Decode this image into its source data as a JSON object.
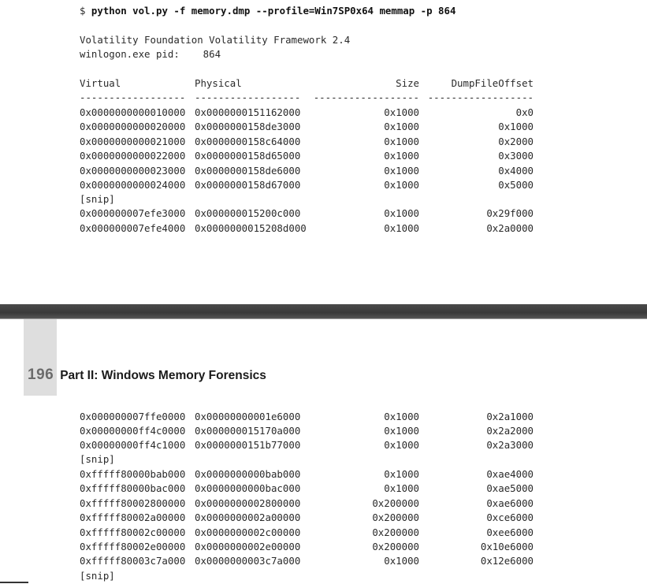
{
  "command": {
    "prompt": "$ ",
    "text": "python vol.py -f memory.dmp --profile=Win7SP0x64 memmap -p 864"
  },
  "output": {
    "banner": "Volatility Foundation Volatility Framework 2.4",
    "pid_label": "winlogon.exe pid:",
    "pid_value": "864"
  },
  "table": {
    "headers": {
      "virtual": "Virtual",
      "physical": "Physical",
      "size": "Size",
      "offset": "DumpFileOffset"
    },
    "separators": {
      "virtual": "------------------",
      "physical": "------------------",
      "size": "------------------",
      "offset": "------------------"
    },
    "snip": "[snip]",
    "rows_top_a": [
      {
        "virtual": "0x0000000000010000",
        "physical": "0x0000000151162000",
        "size": "0x1000",
        "offset": "0x0"
      },
      {
        "virtual": "0x0000000000020000",
        "physical": "0x0000000158de3000",
        "size": "0x1000",
        "offset": "0x1000"
      },
      {
        "virtual": "0x0000000000021000",
        "physical": "0x0000000158c64000",
        "size": "0x1000",
        "offset": "0x2000"
      },
      {
        "virtual": "0x0000000000022000",
        "physical": "0x0000000158d65000",
        "size": "0x1000",
        "offset": "0x3000"
      },
      {
        "virtual": "0x0000000000023000",
        "physical": "0x0000000158de6000",
        "size": "0x1000",
        "offset": "0x4000"
      },
      {
        "virtual": "0x0000000000024000",
        "physical": "0x0000000158d67000",
        "size": "0x1000",
        "offset": "0x5000"
      }
    ],
    "rows_top_b": [
      {
        "virtual": "0x000000007efe3000",
        "physical": "0x000000015200c000",
        "size": "0x1000",
        "offset": "0x29f000"
      },
      {
        "virtual": "0x000000007efe4000",
        "physical": "0x0000000015208d000",
        "size": "0x1000",
        "offset": "0x2a0000"
      }
    ],
    "rows_bottom_a": [
      {
        "virtual": "0x000000007ffe0000",
        "physical": "0x00000000001e6000",
        "size": "0x1000",
        "offset": "0x2a1000"
      },
      {
        "virtual": "0x00000000ff4c0000",
        "physical": "0x000000015170a000",
        "size": "0x1000",
        "offset": "0x2a2000"
      },
      {
        "virtual": "0x00000000ff4c1000",
        "physical": "0x0000000151b77000",
        "size": "0x1000",
        "offset": "0x2a3000"
      }
    ],
    "rows_bottom_b": [
      {
        "virtual": "0xfffff80000bab000",
        "physical": "0x0000000000bab000",
        "size": "0x1000",
        "offset": "0xae4000"
      },
      {
        "virtual": "0xfffff80000bac000",
        "physical": "0x0000000000bac000",
        "size": "0x1000",
        "offset": "0xae5000"
      },
      {
        "virtual": "0xfffff80002800000",
        "physical": "0x0000000002800000",
        "size": "0x200000",
        "offset": "0xae6000"
      },
      {
        "virtual": "0xfffff80002a00000",
        "physical": "0x0000000002a00000",
        "size": "0x200000",
        "offset": "0xce6000"
      },
      {
        "virtual": "0xfffff80002c00000",
        "physical": "0x0000000002c00000",
        "size": "0x200000",
        "offset": "0xee6000"
      },
      {
        "virtual": "0xfffff80002e00000",
        "physical": "0x0000000002e00000",
        "size": "0x200000",
        "offset": "0x10e6000"
      },
      {
        "virtual": "0xfffff80003c7a000",
        "physical": "0x0000000003c7a000",
        "size": "0x1000",
        "offset": "0x12e6000"
      }
    ]
  },
  "page_header": {
    "page_number": "196",
    "section_title": "Part II: Windows Memory Forensics"
  }
}
